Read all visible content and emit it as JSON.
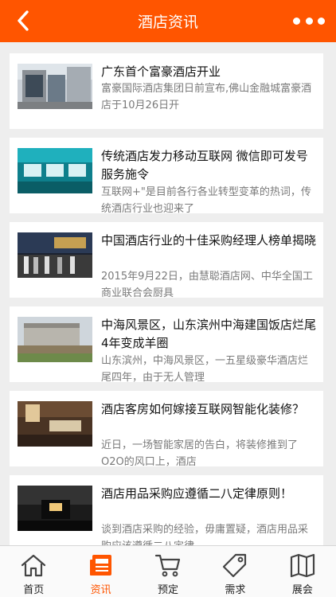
{
  "header": {
    "title": "酒店资讯",
    "back_icon": "back-chevron-icon",
    "more_icon": "more-dots-icon",
    "color": "#ff5500"
  },
  "articles": [
    {
      "title": "广东首个富豪酒店开业",
      "desc": "富豪国际酒店集团日前宣布,佛山金融城富豪酒店于10月26日开"
    },
    {
      "title": "传统酒店发力移动互联网 微信即可发号服务施令",
      "desc": "互联网+\"是目前各行各业转型变革的热词，传统酒店行业也迎来了"
    },
    {
      "title": "中国酒店行业的十佳采购经理人榜单揭晓",
      "desc": "2015年9月22日，由慧聪酒店网、中华全国工商业联合会厨具"
    },
    {
      "title": "中海风景区，山东滨州中海建国饭店烂尾4年变成羊圈",
      "desc": "山东滨州，中海风景区，一五星级豪华酒店烂尾四年，由于无人管理"
    },
    {
      "title": "酒店客房如何嫁接互联网智能化装修？",
      "desc": "近日，一场智能家居的告白，将装修推到了O2O的风口上，酒店"
    },
    {
      "title": "酒店用品采购应遵循二八定律原则！",
      "desc": "谈到酒店采购的经验，毋庸置疑，酒店用品采购应该遵循二八定律"
    }
  ],
  "tabs": [
    {
      "label": "首页",
      "icon": "home-icon"
    },
    {
      "label": "资讯",
      "icon": "news-icon",
      "active": true
    },
    {
      "label": "预定",
      "icon": "cart-icon"
    },
    {
      "label": "需求",
      "icon": "tag-icon"
    },
    {
      "label": "展会",
      "icon": "map-icon"
    }
  ]
}
